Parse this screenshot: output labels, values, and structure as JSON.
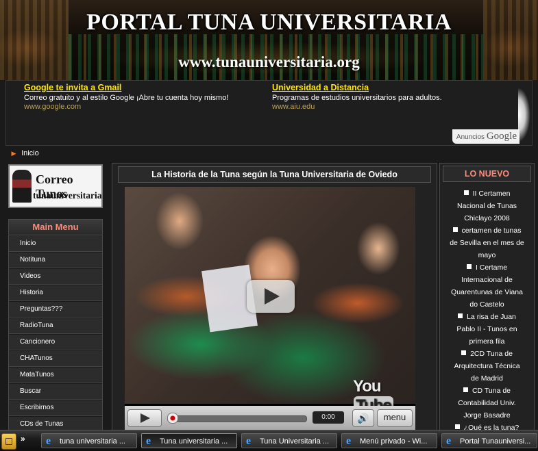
{
  "header": {
    "title": "PORTAL TUNA UNIVERSITARIA",
    "url": "www.tunauniversitaria.org"
  },
  "ads": {
    "items": [
      {
        "title": "Google te invita a Gmail",
        "description": "Correo gratuito y al estilo Google ¡Abre tu cuenta hoy mismo!",
        "url": "www.google.com"
      },
      {
        "title": "Universidad a Distancia",
        "description": "Programas de estudios universitarios para adultos.",
        "url": "www.aiu.edu"
      }
    ],
    "attribution_prefix": "Anuncios",
    "attribution_brand": "Google"
  },
  "breadcrumb": {
    "current": "Inicio"
  },
  "left": {
    "banner": {
      "line1": "Correo Tunos",
      "line2": "tunauniversitaria.org"
    },
    "menu": {
      "title": "Main Menu",
      "items": [
        "Inicio",
        "Notituna",
        "Videos",
        "Historia",
        "Preguntas???",
        "RadioTuna",
        "Cancionero",
        "CHATunos",
        "MataTunos",
        "Buscar",
        "Escribirnos",
        "CDs de Tunas"
      ]
    }
  },
  "center": {
    "title": "La Historia de la Tuna según la Tuna Universitaria de Oviedo",
    "video": {
      "logo_you": "You",
      "logo_tube": "Tube",
      "time": "0:00",
      "menu_label": "menu",
      "progress": 0
    }
  },
  "right": {
    "title": "LO NUEVO",
    "items": [
      "II Certamen Nacional de Tunas Chiclayo 2008",
      "certamen de tunas de Sevilla en el mes de mayo",
      "I Certame Internacional de Quarentunas de Viana do Castelo",
      "La risa de Juan Pablo II - Tunos en primera fila",
      "2CD Tuna de Arquitectura Técnica de Madrid",
      "CD Tuna de Contabilidad Univ. Jorge Basadre",
      "¿Qué es la tuna?"
    ]
  },
  "taskbar": {
    "chevron": "»",
    "tasks": [
      "tuna universitaria ...",
      "Tuna universitaria ...",
      "Tuna Universitaria ...",
      "Menú privado - Wi...",
      "Portal Tunauniversi..."
    ],
    "active_index": 1
  },
  "colors": {
    "ad_title": "#ffe800",
    "menu_head": "#ff8a7a",
    "breadcrumb_arrow": "#ff7a1a"
  }
}
